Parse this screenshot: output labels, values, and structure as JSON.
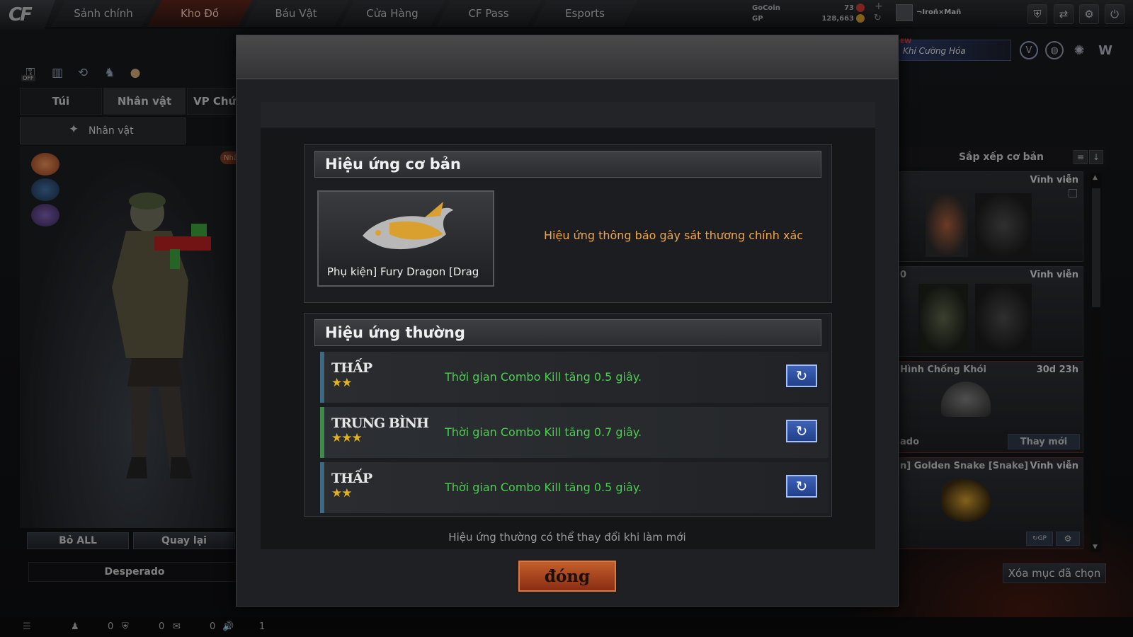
{
  "topbar": {
    "tabs": [
      {
        "label": "Sảnh chính",
        "active": false
      },
      {
        "label": "Kho Đồ",
        "active": true
      },
      {
        "label": "Báu Vật",
        "active": false
      },
      {
        "label": "Cửa Hàng",
        "active": false
      },
      {
        "label": "CF Pass",
        "active": false
      },
      {
        "label": "Esports",
        "active": false
      }
    ],
    "gocoin_label": "GoCoin",
    "gocoin_value": "73",
    "gp_label": "GP",
    "gp_value": "128,663",
    "username": "¬Iroñ×Mañ",
    "promo_label": "Khí Cường Hóa",
    "promo_tag": "EW"
  },
  "left": {
    "tabs": [
      "Túi",
      "Nhân vật",
      "VP Chức"
    ],
    "subtab": "Nhân vật",
    "badge": "Nhâ",
    "toggle_label": "OFF",
    "btn_remove_all": "Bỏ ALL",
    "btn_back": "Quay lại",
    "character_name": "Desperado"
  },
  "right": {
    "sort_label": "Sắp xếp cơ bản",
    "cards": [
      {
        "title": "",
        "duration": "Vĩnh viễn"
      },
      {
        "title": "0",
        "duration": "Vĩnh viễn"
      },
      {
        "title": "Hình Chống Khói",
        "duration": "30d 23h",
        "sub": "ado",
        "action": "Thay mới"
      },
      {
        "title": "n] Golden Snake [Snake]",
        "duration": "Vĩnh viễn",
        "gp": "GP"
      }
    ],
    "clear_selected": "Xóa mục đã chọn"
  },
  "status": {
    "counts": [
      "0",
      "0",
      "0",
      "1"
    ]
  },
  "modal": {
    "basic_title": "Hiệu ứng cơ bản",
    "item_name": "Phụ kiện] Fury Dragon [Drag",
    "basic_effect": "Hiệu ứng thông báo gây sát thương chính xác",
    "normal_title": "Hiệu ứng thường",
    "rows": [
      {
        "tier": "THẤP",
        "stars": "★★",
        "effect": "Thời gian Combo Kill tăng 0.5 giây."
      },
      {
        "tier": "TRUNG BÌNH",
        "stars": "★★★",
        "effect": "Thời gian Combo Kill tăng 0.7 giây."
      },
      {
        "tier": "THẤP",
        "stars": "★★",
        "effect": "Thời gian Combo Kill tăng 0.5 giây."
      }
    ],
    "note": "Hiệu ứng thường có thể thay đổi khi làm mới",
    "close_label": "đóng"
  },
  "colors": {
    "accent_orange": "#f0a64a",
    "effect_green": "#46d24a",
    "close_button": "#b04a22"
  }
}
